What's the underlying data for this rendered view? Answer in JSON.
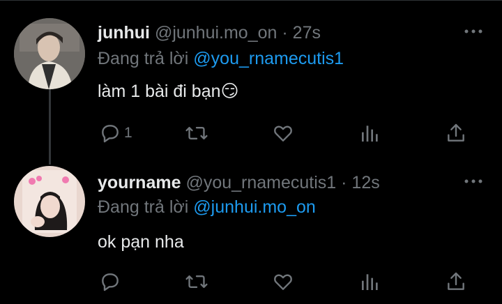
{
  "tweets": [
    {
      "name": "junhui",
      "handle": "@junhui.mo_on",
      "time": "· 27s",
      "reply_prefix": "Đang trả lời",
      "reply_to": "@you_rnamecutis1",
      "text": "làm 1 bài đi bạn😏",
      "reply_count": "1"
    },
    {
      "name": "yourname",
      "handle": "@you_rnamecutis1",
      "time": "· 12s",
      "reply_prefix": "Đang trả lời",
      "reply_to": "@junhui.mo_on",
      "text": "ok pạn nha",
      "reply_count": ""
    }
  ],
  "colors": {
    "background": "#000000",
    "text": "#e7e9ea",
    "muted": "#71767b",
    "accent": "#1d9bf0"
  },
  "icons": [
    "reply-icon",
    "retweet-icon",
    "like-icon",
    "views-icon",
    "share-icon",
    "more-icon"
  ]
}
